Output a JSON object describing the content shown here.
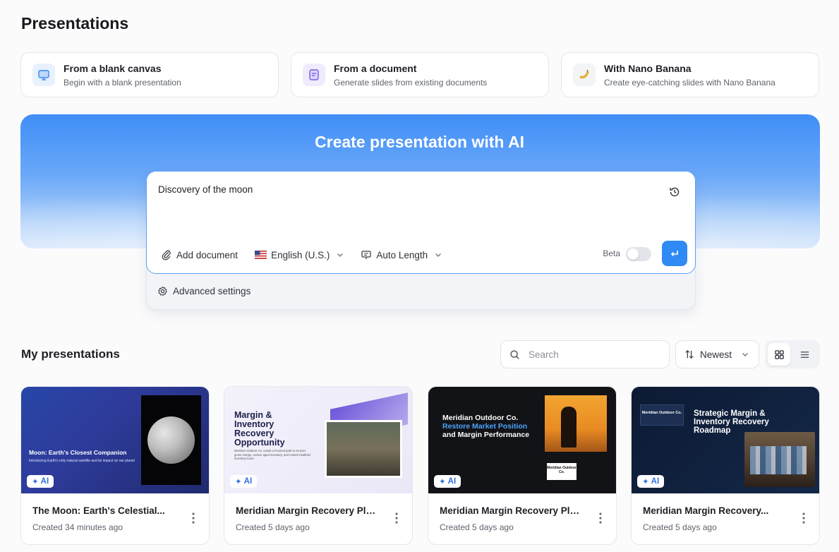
{
  "page": {
    "title": "Presentations"
  },
  "options": [
    {
      "title": "From a blank canvas",
      "desc": "Begin with a blank presentation",
      "icon": "presentation-board-icon"
    },
    {
      "title": "From a document",
      "desc": "Generate slides from existing documents",
      "icon": "document-icon"
    },
    {
      "title": "With Nano Banana",
      "desc": "Create eye-catching slides with Nano Banana",
      "icon": "banana-icon"
    }
  ],
  "hero": {
    "title": "Create presentation with AI",
    "prompt_value": "Discovery of the moon",
    "add_document": "Add document",
    "language": "English (U.S.)",
    "length": "Auto Length",
    "beta_label": "Beta",
    "beta_enabled": false,
    "advanced": "Advanced settings"
  },
  "my_presentations": {
    "title": "My presentations",
    "search_placeholder": "Search",
    "sort_label": "Newest",
    "view_mode": "grid",
    "items": [
      {
        "title": "The Moon: Earth's Celestial...",
        "date": "Created 34 minutes ago",
        "badge": "AI",
        "thumb_title": "Moon: Earth's Closest Companion",
        "thumb_sub": "Introducing Earth's only natural satellite and its impact on our planet"
      },
      {
        "title": "Meridian Margin Recovery Plan",
        "date": "Created 5 days ago",
        "badge": "AI",
        "thumb_title": "Margin & Inventory Recovery Opportunity",
        "thumb_sub": "Meridian Outdoor Co. needs a focused path to recover gross margin, reduce aged inventory, and restore healthier inventory turns."
      },
      {
        "title": "Meridian Margin Recovery Plan",
        "date": "Created 5 days ago",
        "badge": "AI",
        "thumb_title_a": "Meridian Outdoor Co.",
        "thumb_title_b": "Restore Market Position",
        "thumb_title_c": "and Margin Performance",
        "thumb_box": "Meridian Outdoor Co."
      },
      {
        "title": "Meridian Margin Recovery...",
        "date": "Created 5 days ago",
        "badge": "AI",
        "thumb_logo": "Meridian Outdoor Co.",
        "thumb_title": "Strategic Margin & Inventory Recovery Roadmap"
      }
    ]
  },
  "colors": {
    "accent": "#2f8af5",
    "hero_top": "#3f8ef7",
    "border": "#e6e7eb"
  }
}
